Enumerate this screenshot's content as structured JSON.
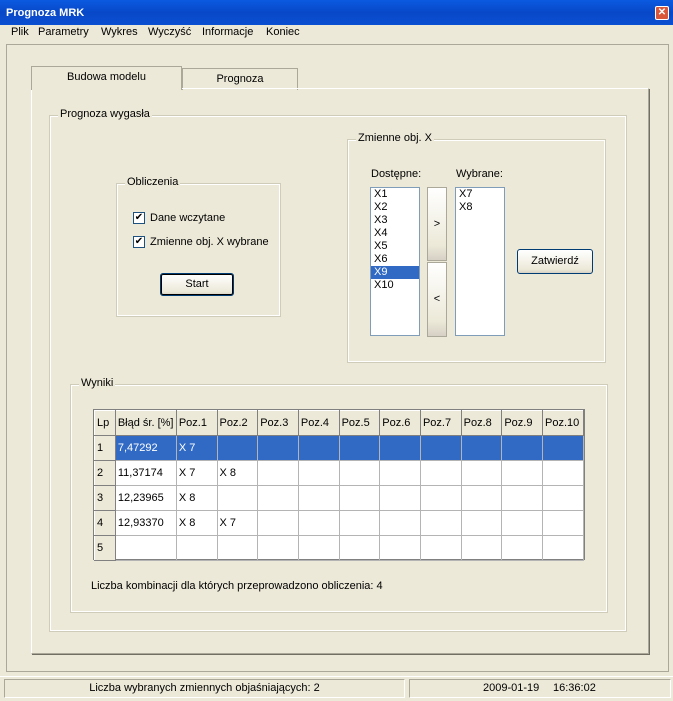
{
  "window": {
    "title": "Prognoza MRK",
    "close_label": "✕"
  },
  "menu": [
    "Plik",
    "Parametry",
    "Wykres",
    "Wyczyść",
    "Informacje",
    "Koniec"
  ],
  "tabs": [
    {
      "label": "Budowa modelu"
    },
    {
      "label": "Prognoza"
    }
  ],
  "forecast_group": {
    "label": "Prognoza wygasła"
  },
  "calc_group": {
    "label": "Obliczenia",
    "data_loaded": {
      "label": "Dane wczytane",
      "checked": true
    },
    "vars_selected": {
      "label": "Zmienne obj. X wybrane",
      "checked": true
    },
    "start_label": "Start"
  },
  "vars_group": {
    "label": "Zmienne obj. X",
    "available_label": "Dostępne:",
    "selected_label": "Wybrane:",
    "available": [
      "X1",
      "X2",
      "X3",
      "X4",
      "X5",
      "X6",
      "X9",
      "X10"
    ],
    "available_selected": "X9",
    "selected": [
      "X7",
      "X8"
    ],
    "add_label": ">",
    "remove_label": "<",
    "confirm_label": "Zatwierdź"
  },
  "results_group": {
    "label": "Wyniki",
    "columns": [
      "Lp",
      "Błąd śr. [%]",
      "Poz.1",
      "Poz.2",
      "Poz.3",
      "Poz.4",
      "Poz.5",
      "Poz.6",
      "Poz.7",
      "Poz.8",
      "Poz.9",
      "Poz.10"
    ],
    "rows": [
      [
        "1",
        "7,47292",
        "X 7",
        "",
        "",
        "",
        "",
        "",
        "",
        "",
        "",
        ""
      ],
      [
        "2",
        "11,37174",
        "X 7",
        "X 8",
        "",
        "",
        "",
        "",
        "",
        "",
        "",
        ""
      ],
      [
        "3",
        "12,23965",
        "X 8",
        "",
        "",
        "",
        "",
        "",
        "",
        "",
        "",
        ""
      ],
      [
        "4",
        "12,93370",
        "X 8",
        "X 7",
        "",
        "",
        "",
        "",
        "",
        "",
        "",
        ""
      ],
      [
        "5",
        "",
        "",
        "",
        "",
        "",
        "",
        "",
        "",
        "",
        "",
        ""
      ]
    ],
    "selected_row": 0,
    "summary": "Liczba kombinacji dla których przeprowadzono obliczenia: 4"
  },
  "statusbar": {
    "selected_vars": "Liczba wybranych zmiennych objaśniających: 2",
    "date": "2009-01-19",
    "time": "16:36:02"
  },
  "colors": {
    "titlebar": "#0a5ae0",
    "selection": "#316ac5",
    "face": "#ece9d8"
  }
}
